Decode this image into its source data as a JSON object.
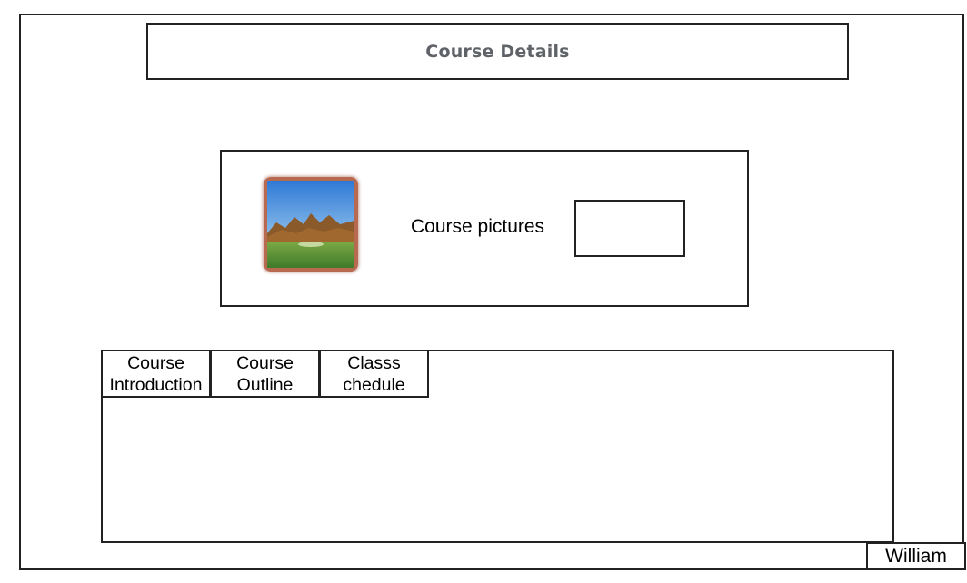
{
  "header": {
    "title": "Course Details"
  },
  "pictures": {
    "label": "Course pictures",
    "thumbnail_icon": "landscape-image-icon"
  },
  "tabs": [
    {
      "line1": "Course",
      "line2": "Introduction"
    },
    {
      "line1": "Course",
      "line2": "Outline"
    },
    {
      "line1": "Classs",
      "line2": "chedule"
    }
  ],
  "footer": {
    "user": "William"
  }
}
